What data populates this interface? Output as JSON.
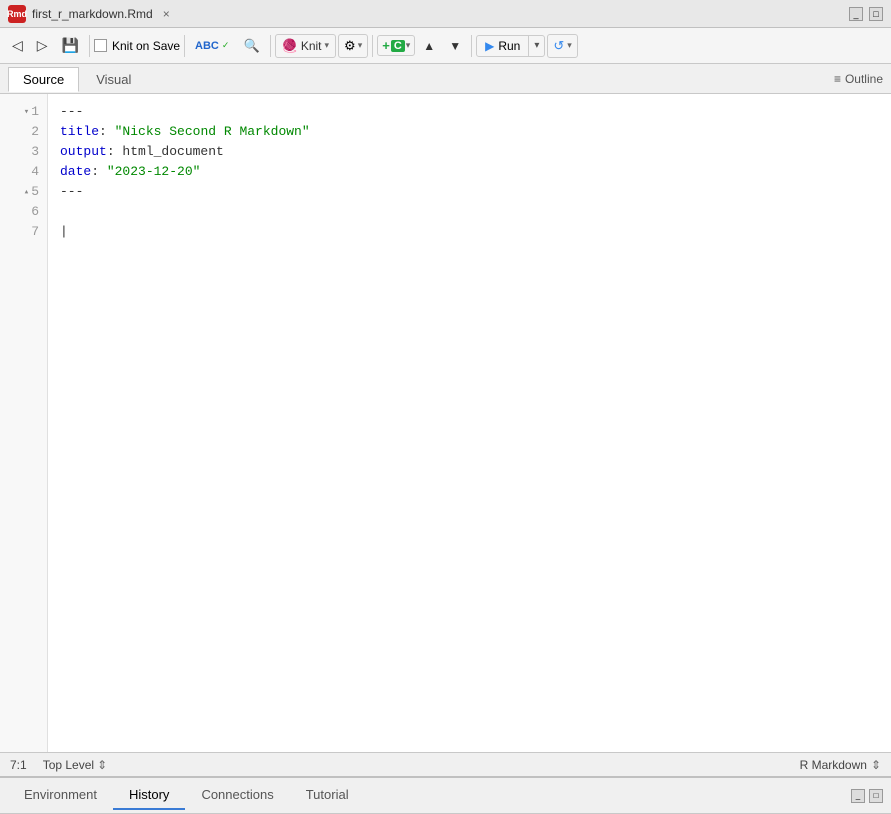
{
  "titlebar": {
    "file_icon_label": "Rmd",
    "tab_label": "first_r_markdown.Rmd",
    "close_symbol": "×"
  },
  "toolbar": {
    "back_icon": "◁",
    "forward_icon": "▷",
    "save_icon": "💾",
    "knit_on_save_label": "Knit on Save",
    "spellcheck_icon": "ABC",
    "search_icon": "🔍",
    "knit_label": "Knit",
    "knit_dropdown": "▾",
    "gear_icon": "⚙",
    "gear_dropdown": "▾",
    "add_chunk_icon": "+",
    "add_chunk_label": "C",
    "add_chunk_dropdown": "▾",
    "up_icon": "▲",
    "down_icon": "▼",
    "run_label": "Run",
    "run_dropdown": "▾",
    "rerun_icon": "↺",
    "rerun_dropdown": "▾"
  },
  "editor_tabs": {
    "source_label": "Source",
    "visual_label": "Visual",
    "outline_label": "Outline",
    "outline_icon": "≡"
  },
  "code_lines": [
    {
      "number": "1",
      "has_fold": true,
      "content": "---",
      "parts": [
        {
          "text": "---",
          "class": "yaml-dash"
        }
      ]
    },
    {
      "number": "2",
      "has_fold": false,
      "content": "title: \"Nicks Second R Markdown\"",
      "parts": [
        {
          "text": "title",
          "class": "yaml-key"
        },
        {
          "text": ": ",
          "class": "yaml-colon"
        },
        {
          "text": "\"Nicks Second R Markdown\"",
          "class": "yaml-string"
        }
      ]
    },
    {
      "number": "3",
      "has_fold": false,
      "content": "output: html_document",
      "parts": [
        {
          "text": "output",
          "class": "yaml-key"
        },
        {
          "text": ": ",
          "class": "yaml-colon"
        },
        {
          "text": "html_document",
          "class": "yaml-value"
        }
      ]
    },
    {
      "number": "4",
      "has_fold": false,
      "content": "date: \"2023-12-20\"",
      "parts": [
        {
          "text": "date",
          "class": "yaml-key"
        },
        {
          "text": ": ",
          "class": "yaml-colon"
        },
        {
          "text": "\"2023-12-20\"",
          "class": "yaml-string"
        }
      ]
    },
    {
      "number": "5",
      "has_fold": true,
      "content": "---",
      "parts": [
        {
          "text": "---",
          "class": "yaml-dash"
        }
      ]
    },
    {
      "number": "6",
      "has_fold": false,
      "content": "",
      "parts": []
    },
    {
      "number": "7",
      "has_fold": false,
      "content": "",
      "parts": [],
      "cursor": true
    }
  ],
  "statusbar": {
    "position": "7:1",
    "context": "Top Level",
    "stepper": "⇕",
    "file_type": "R Markdown",
    "file_type_stepper": "⇕"
  },
  "bottom_panel": {
    "tabs": [
      {
        "label": "Environment",
        "active": false
      },
      {
        "label": "History",
        "active": true
      },
      {
        "label": "Connections",
        "active": false
      },
      {
        "label": "Tutorial",
        "active": false
      }
    ]
  }
}
